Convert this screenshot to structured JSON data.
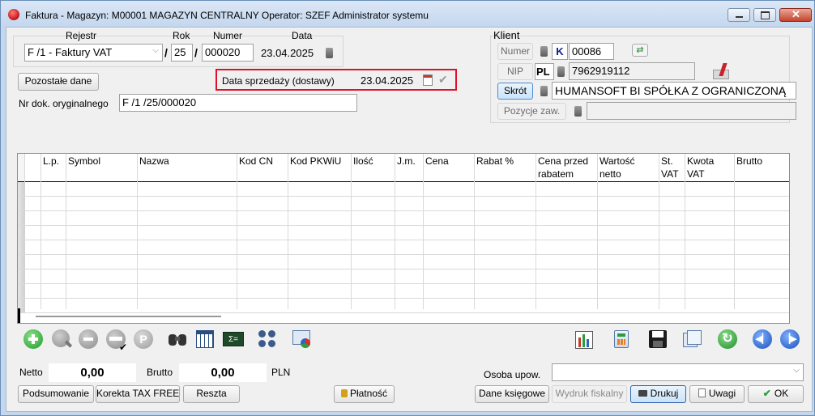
{
  "window": {
    "title": "Faktura - Magazyn: M00001 MAGAZYN CENTRALNY  Operator: SZEF Administrator systemu"
  },
  "header": {
    "rejestr_label": "Rejestr",
    "rejestr_value": "F /1   - Faktury VAT",
    "rok_label": "Rok",
    "rok_value": "25",
    "numer_label": "Numer",
    "numer_value": "000020",
    "data_label": "Data",
    "data_value": "23.04.2025",
    "separator": "/",
    "pozostale_label": "Pozostałe dane",
    "sale_date_label": "Data sprzedaży (dostawy)",
    "sale_date_value": "23.04.2025",
    "nr_dok_label": "Nr dok. oryginalnego",
    "nr_dok_value": "F /1  /25/000020"
  },
  "client": {
    "group_label": "Klient",
    "numer_button": "Numer",
    "numer_prefix": "K",
    "numer_value": "00086",
    "nip_button": "NIP",
    "nip_prefix": "PL",
    "nip_value": "7962919112",
    "skrot_button": "Skrót",
    "skrot_value": "HUMANSOFT BI SPÓŁKA Z OGRANICZONĄ",
    "pozycje_button": "Pozycje zaw.",
    "pozycje_value": ""
  },
  "grid": {
    "columns": [
      {
        "l1": "L.p.",
        "l2": ""
      },
      {
        "l1": "Symbol",
        "l2": ""
      },
      {
        "l1": "Nazwa",
        "l2": ""
      },
      {
        "l1": "Kod  CN",
        "l2": ""
      },
      {
        "l1": "Kod  PKWiU",
        "l2": ""
      },
      {
        "l1": "Ilość",
        "l2": ""
      },
      {
        "l1": "J.m.",
        "l2": ""
      },
      {
        "l1": "Cena",
        "l2": ""
      },
      {
        "l1": "Rabat %",
        "l2": ""
      },
      {
        "l1": "Cena przed",
        "l2": "rabatem"
      },
      {
        "l1": "Wartość",
        "l2": "netto"
      },
      {
        "l1": "St.",
        "l2": "VAT"
      },
      {
        "l1": "Kwota",
        "l2": "VAT"
      },
      {
        "l1": "Brutto",
        "l2": ""
      }
    ],
    "row_count": 9
  },
  "toolbar": {
    "icons": [
      "add-icon",
      "view-icon",
      "remove-icon",
      "edit-icon",
      "p-icon",
      "binoculars-icon",
      "table-icon",
      "formula-icon",
      "components-icon",
      "export-icon",
      "chart-icon",
      "calculator-icon",
      "save-icon",
      "copy-icon",
      "refresh-icon",
      "prev-icon",
      "next-icon"
    ]
  },
  "footer": {
    "netto_label": "Netto",
    "netto_value": "0,00",
    "brutto_label": "Brutto",
    "brutto_value": "0,00",
    "currency": "PLN",
    "osoba_label": "Osoba upow.",
    "osoba_value": "",
    "buttons": {
      "podsumowanie": "Podsumowanie",
      "korekta": "Korekta TAX FREE",
      "reszta": "Reszta",
      "platnosc": "Płatność",
      "dane_ksiegowe": "Dane księgowe",
      "wydruk": "Wydruk fiskalny",
      "drukuj": "Drukuj",
      "uwagi": "Uwagi",
      "ok": "OK"
    }
  },
  "colors": {
    "accent_border": "#e0102a",
    "window_frame": "#c3d7ee"
  }
}
